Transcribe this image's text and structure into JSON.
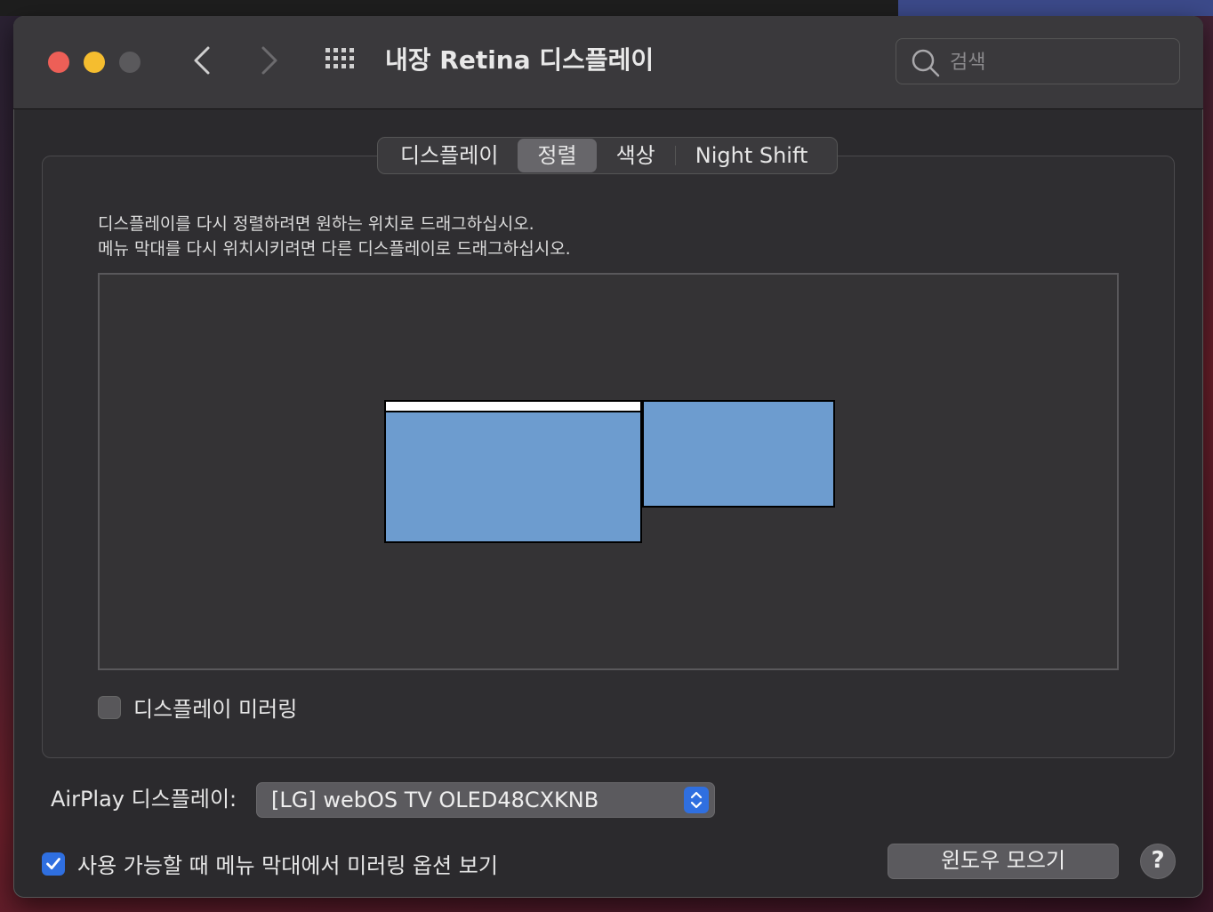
{
  "window": {
    "title": "내장 Retina 디스플레이",
    "search_placeholder": "검색"
  },
  "tabs": [
    {
      "label": "디스플레이",
      "active": false
    },
    {
      "label": "정렬",
      "active": true
    },
    {
      "label": "색상",
      "active": false
    },
    {
      "label": "Night Shift",
      "active": false
    }
  ],
  "arrangement": {
    "instruction_1": "디스플레이를 다시 정렬하려면 원하는 위치로 드래그하십시오.",
    "instruction_2": "메뉴 막대를 다시 위치시키려면 다른 디스플레이로 드래그하십시오.",
    "display_color": "#6d9ccf"
  },
  "mirroring": {
    "label": "디스플레이 미러링",
    "checked": false
  },
  "airplay": {
    "label": "AirPlay 디스플레이:",
    "selected": "[LG] webOS TV OLED48CXKNB"
  },
  "menubar_option": {
    "label": "사용 가능할 때 메뉴 막대에서 미러링 옵션 보기",
    "checked": true
  },
  "buttons": {
    "gather": "윈도우 모으기",
    "help": "?"
  },
  "colors": {
    "accent": "#2f6fe0",
    "close": "#ed5f57",
    "minimize": "#f5bd2f"
  }
}
